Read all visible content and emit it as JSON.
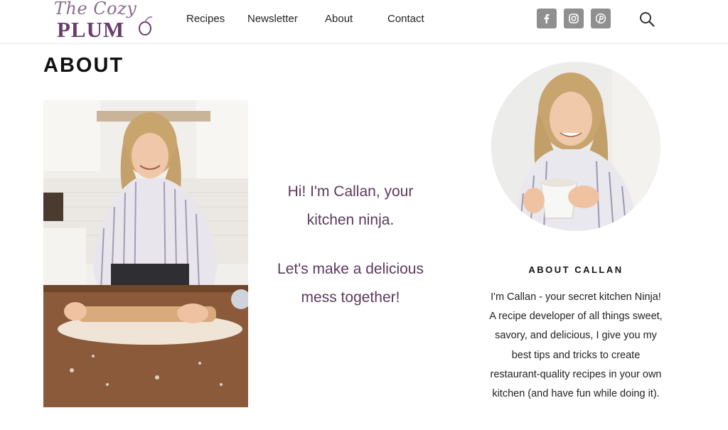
{
  "brand": {
    "logo_script": "The Cozy",
    "logo_main": "PLUM",
    "colors": {
      "plum": "#6b3c6b",
      "plum_light": "#8a6d8f",
      "accent_text": "#5c3a5c",
      "social_bg": "#8f8f8f"
    }
  },
  "nav": {
    "items": [
      "Recipes",
      "Newsletter",
      "About",
      "Contact"
    ]
  },
  "social": [
    {
      "name": "facebook-icon",
      "glyph": "f"
    },
    {
      "name": "instagram-icon",
      "glyph": ""
    },
    {
      "name": "pinterest-icon",
      "glyph": "P"
    }
  ],
  "search": {
    "icon": "search-icon"
  },
  "main": {
    "title": "ABOUT",
    "photo_left_icon": "kitchen-rolling-dough-photo",
    "intro_line1": "Hi! I'm Callan, your kitchen ninja.",
    "intro_line2": "Let's make a delicious mess together!"
  },
  "sidebar": {
    "avatar_icon": "callan-portrait-photo",
    "heading": "ABOUT CALLAN",
    "bio": "I'm Callan - your secret kitchen Ninja! A recipe developer of all things sweet, savory, and delicious, I give you my best tips and tricks to create restaurant-quality recipes in your own kitchen (and have fun while doing it)."
  }
}
